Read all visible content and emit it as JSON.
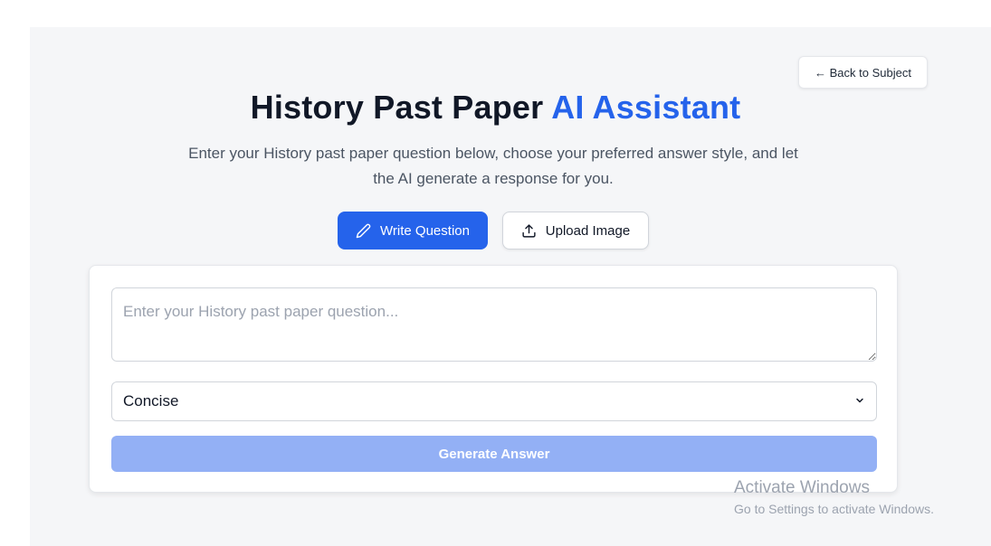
{
  "header": {
    "back_label": "← Back to Subject",
    "title_main": "History Past Paper ",
    "title_accent": "AI Assistant",
    "subtitle": "Enter your History past paper question below, choose your preferred answer style, and let the AI generate a response for you."
  },
  "modes": {
    "write_label": "Write Question",
    "write_icon": "pencil-icon",
    "upload_label": "Upload Image",
    "upload_icon": "upload-icon",
    "active": "write"
  },
  "form": {
    "question_placeholder": "Enter your History past paper question...",
    "question_value": "",
    "answer_style_selected": "Concise",
    "generate_label": "Generate Answer",
    "generate_enabled": false
  },
  "colors": {
    "accent": "#2563eb",
    "disabled_button": "#93b0f5"
  },
  "watermark": {
    "title": "Activate Windows",
    "subtitle": "Go to Settings to activate Windows."
  }
}
